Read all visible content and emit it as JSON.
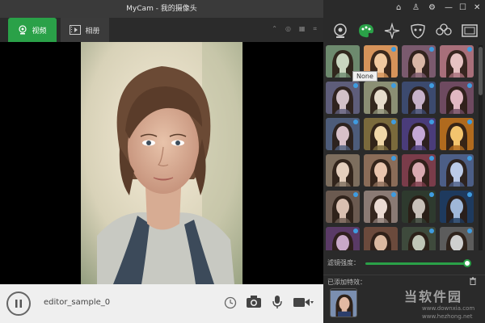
{
  "window": {
    "title": "MyCam - 我的摄像头"
  },
  "tabs": {
    "video": "视频",
    "album": "相册"
  },
  "bottombar": {
    "file_name": "editor_sample_0"
  },
  "filters": {
    "tooltip": "None",
    "strength_label": "滤镜强度：",
    "strength": 0.97,
    "added_label": "已添加特效："
  },
  "watermark": {
    "brand": "当软件园",
    "url1": "www.downxia.com",
    "url2": "www.hezhong.net"
  },
  "colors": {
    "accent": "#2aa148",
    "badge": "#3f9ce0"
  }
}
